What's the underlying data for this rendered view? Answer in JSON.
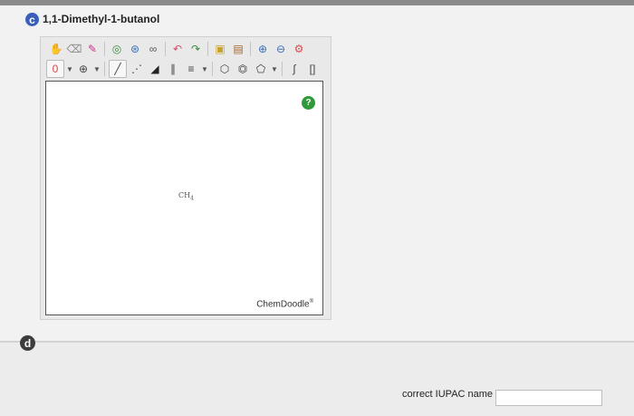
{
  "part_c": {
    "badge": "c",
    "title": "1,1-Dimethyl-1-butanol",
    "editor": {
      "toolbar_row1": [
        {
          "name": "hand-icon",
          "glyph": "✋",
          "color": "#d99a2b"
        },
        {
          "name": "eraser-icon",
          "glyph": "⌫",
          "color": "#8a8a8a"
        },
        {
          "name": "pencil-icon",
          "glyph": "✎",
          "color": "#c4348a"
        },
        {
          "name": "lasso-icon",
          "glyph": "◎",
          "color": "#3b8a3b"
        },
        {
          "name": "rotate-icon",
          "glyph": "⊛",
          "color": "#3b6fb8"
        },
        {
          "name": "flip-icon",
          "glyph": "∞",
          "color": "#555555"
        },
        {
          "name": "undo-icon",
          "glyph": "↶",
          "color": "#d94a6b"
        },
        {
          "name": "redo-icon",
          "glyph": "↷",
          "color": "#3b8a3b"
        },
        {
          "name": "template-icon",
          "glyph": "▣",
          "color": "#c9a227"
        },
        {
          "name": "clean-icon",
          "glyph": "▤",
          "color": "#a0672b"
        },
        {
          "name": "zoom-in-icon",
          "glyph": "⊕",
          "color": "#3b6fb8"
        },
        {
          "name": "zoom-out-icon",
          "glyph": "⊖",
          "color": "#3b6fb8"
        },
        {
          "name": "settings-icon",
          "glyph": "⚙",
          "color": "#d94a4a"
        }
      ],
      "toolbar_row2": [
        {
          "name": "charge-icon",
          "glyph": "0",
          "color": "#d94a4a",
          "caret": true,
          "boxed": true
        },
        {
          "name": "plus-charge-icon",
          "glyph": "⊕",
          "color": "#444444",
          "caret": true
        },
        {
          "name": "single-bond-icon",
          "glyph": "╱",
          "color": "#444444",
          "boxed": true
        },
        {
          "name": "dashed-bond-icon",
          "glyph": "⋰",
          "color": "#444444"
        },
        {
          "name": "wedge-bond-icon",
          "glyph": "◢",
          "color": "#222222"
        },
        {
          "name": "double-bond-icon",
          "glyph": "∥",
          "color": "#444444"
        },
        {
          "name": "triple-bond-icon",
          "glyph": "≡",
          "color": "#444444",
          "caret": true
        },
        {
          "name": "hexagon-ring-icon",
          "glyph": "⬡",
          "color": "#444444"
        },
        {
          "name": "benzene-ring-icon",
          "glyph": "⏣",
          "color": "#444444"
        },
        {
          "name": "pentagon-ring-icon",
          "glyph": "⬠",
          "color": "#444444",
          "caret": true
        },
        {
          "name": "polymer-icon",
          "glyph": "∫",
          "color": "#444444"
        },
        {
          "name": "bracket-icon",
          "glyph": "[]",
          "color": "#444444"
        }
      ],
      "help_label": "?",
      "molecule": {
        "text": "CH",
        "sub": "4"
      },
      "logo": "ChemDoodle",
      "logo_mark": "®"
    }
  },
  "part_d": {
    "badge": "d",
    "iupac_label": "correct IUPAC name",
    "iupac_value": "",
    "iupac_placeholder": ""
  }
}
